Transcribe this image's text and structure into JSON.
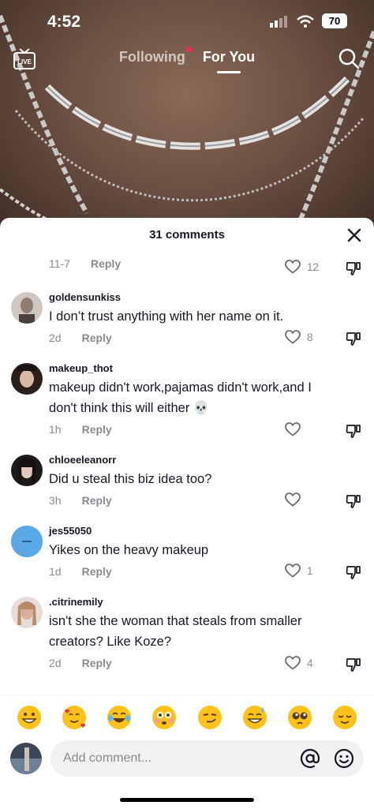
{
  "status": {
    "time": "4:52",
    "battery": "70"
  },
  "nav": {
    "following": "Following",
    "for_you": "For You"
  },
  "sheet": {
    "title": "31 comments"
  },
  "partial_comment": {
    "date": "11-7",
    "reply": "Reply",
    "likes": "12"
  },
  "comments": [
    {
      "user": "goldensunkiss",
      "text": "I don’t trust anything with her name on it.",
      "date": "2d",
      "reply": "Reply",
      "likes": "8"
    },
    {
      "user": "makeup_thot",
      "text": "makeup didn't work,pajamas didn't work,and I don't think this will either 💀",
      "date": "1h",
      "reply": "Reply",
      "likes": ""
    },
    {
      "user": "chloeeleanorr",
      "text": "Did u steal this biz idea too?",
      "date": "3h",
      "reply": "Reply",
      "likes": ""
    },
    {
      "user": "jes55050",
      "text": "Yikes on the heavy makeup",
      "date": "1d",
      "reply": "Reply",
      "likes": "1"
    },
    {
      "user": ".citrinemily",
      "text": "isn't she the woman that steals from smaller creators? Like Koze?",
      "date": "2d",
      "reply": "Reply",
      "likes": "4"
    }
  ],
  "emojis": [
    "😁",
    "🥰",
    "😂",
    "😳",
    "😏",
    "😅",
    "🥺",
    "😌"
  ],
  "input": {
    "placeholder": "Add comment..."
  },
  "icons": {
    "live": "live-icon",
    "search": "search-icon",
    "close": "close-icon",
    "like": "heart-outline-icon",
    "dislike": "thumbs-down-icon",
    "mention": "at-sign-icon",
    "emoji_picker": "smiley-icon"
  },
  "colors": {
    "accent": "#fe2c55",
    "muted": "#8a8b91",
    "text": "#161823"
  }
}
